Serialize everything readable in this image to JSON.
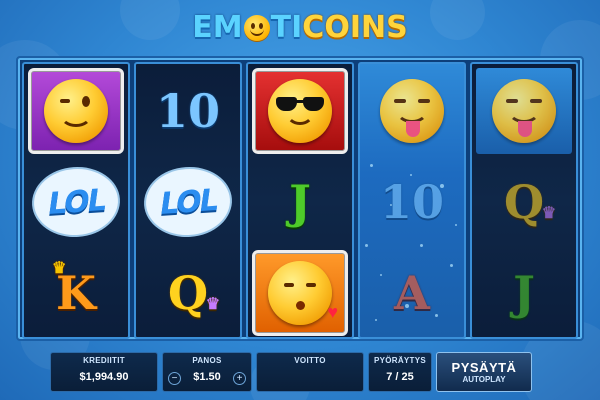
{
  "game": {
    "logo_part1": "EM",
    "logo_part2": "TI",
    "logo_part3": "COINS"
  },
  "reels": [
    {
      "id": 1,
      "symbols": [
        "wink-emoji",
        "lol",
        "K"
      ]
    },
    {
      "id": 2,
      "symbols": [
        "10",
        "lol",
        "Q"
      ]
    },
    {
      "id": 3,
      "symbols": [
        "sunglasses-emoji",
        "J",
        "kiss-emoji"
      ]
    },
    {
      "id": 4,
      "symbols": [
        "tongue-emoji",
        "10",
        "A"
      ],
      "spinning": true
    },
    {
      "id": 5,
      "symbols": [
        "tongue-emoji",
        "Q",
        "J"
      ]
    }
  ],
  "symbols": {
    "lol_text": "LOL",
    "ten": "10",
    "j": "J",
    "q": "Q",
    "k": "K",
    "a": "A"
  },
  "controls": {
    "credit_label": "KREDIITIT",
    "credit_value": "$1,994.90",
    "bet_label": "PANOS",
    "bet_value": "$1.50",
    "bet_minus": "−",
    "bet_plus": "+",
    "win_label": "VOITTO",
    "win_value": "",
    "spins_label": "PYÖRÄYTYS",
    "spins_value": "7 / 25",
    "stop_label": "PYSÄYTÄ",
    "stop_sub": "AUTOPLAY"
  },
  "colors": {
    "background": "#2f86d2",
    "reel_bg": "#0b1d3a",
    "accent": "#5ab4f0"
  }
}
